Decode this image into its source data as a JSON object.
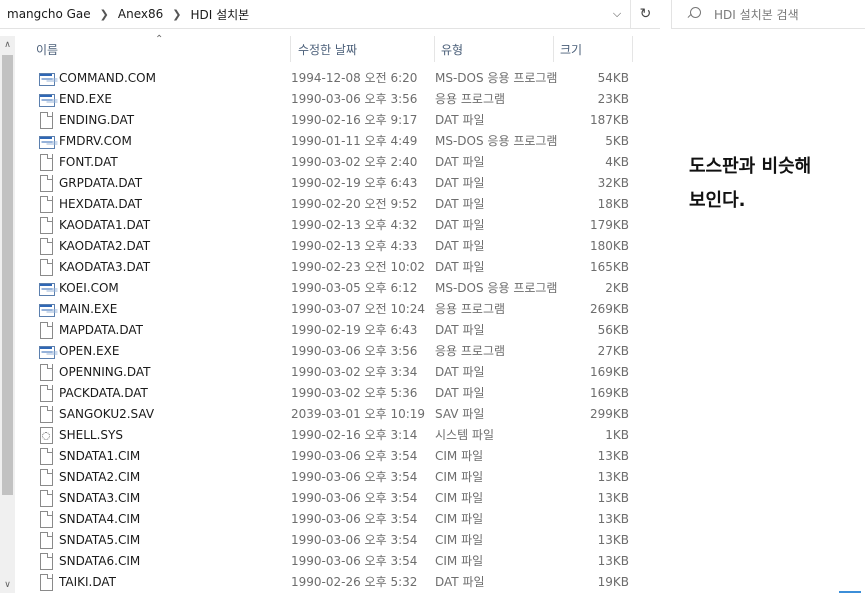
{
  "breadcrumbs": [
    "mangcho Gae",
    "Anex86",
    "HDI 설치본"
  ],
  "search": {
    "placeholder": "HDI 설치본 검색"
  },
  "columns": {
    "name": "이름",
    "date": "수정한 날짜",
    "type": "유형",
    "size": "크기"
  },
  "annotation": [
    "도스판과 비슷해",
    "보인다."
  ],
  "files": [
    {
      "name": "COMMAND.COM",
      "date": "1994-12-08 오전 6:20",
      "type": "MS-DOS 응용 프로그램",
      "size": "54KB",
      "icon": "app-icon"
    },
    {
      "name": "END.EXE",
      "date": "1990-03-06 오후 3:56",
      "type": "응용 프로그램",
      "size": "23KB",
      "icon": "app-icon"
    },
    {
      "name": "ENDING.DAT",
      "date": "1990-02-16 오후 9:17",
      "type": "DAT 파일",
      "size": "187KB",
      "icon": "file-icon"
    },
    {
      "name": "FMDRV.COM",
      "date": "1990-01-11 오후 4:49",
      "type": "MS-DOS 응용 프로그램",
      "size": "5KB",
      "icon": "app-icon"
    },
    {
      "name": "FONT.DAT",
      "date": "1990-03-02 오후 2:40",
      "type": "DAT 파일",
      "size": "4KB",
      "icon": "file-icon"
    },
    {
      "name": "GRPDATA.DAT",
      "date": "1990-02-19 오후 6:43",
      "type": "DAT 파일",
      "size": "32KB",
      "icon": "file-icon"
    },
    {
      "name": "HEXDATA.DAT",
      "date": "1990-02-20 오전 9:52",
      "type": "DAT 파일",
      "size": "18KB",
      "icon": "file-icon"
    },
    {
      "name": "KAODATA1.DAT",
      "date": "1990-02-13 오후 4:32",
      "type": "DAT 파일",
      "size": "179KB",
      "icon": "file-icon"
    },
    {
      "name": "KAODATA2.DAT",
      "date": "1990-02-13 오후 4:33",
      "type": "DAT 파일",
      "size": "180KB",
      "icon": "file-icon"
    },
    {
      "name": "KAODATA3.DAT",
      "date": "1990-02-23 오전 10:02",
      "type": "DAT 파일",
      "size": "165KB",
      "icon": "file-icon"
    },
    {
      "name": "KOEI.COM",
      "date": "1990-03-05 오후 6:12",
      "type": "MS-DOS 응용 프로그램",
      "size": "2KB",
      "icon": "app-icon"
    },
    {
      "name": "MAIN.EXE",
      "date": "1990-03-07 오전 10:24",
      "type": "응용 프로그램",
      "size": "269KB",
      "icon": "app-icon"
    },
    {
      "name": "MAPDATA.DAT",
      "date": "1990-02-19 오후 6:43",
      "type": "DAT 파일",
      "size": "56KB",
      "icon": "file-icon"
    },
    {
      "name": "OPEN.EXE",
      "date": "1990-03-06 오후 3:56",
      "type": "응용 프로그램",
      "size": "27KB",
      "icon": "app-icon"
    },
    {
      "name": "OPENNING.DAT",
      "date": "1990-03-02 오후 3:34",
      "type": "DAT 파일",
      "size": "169KB",
      "icon": "file-icon"
    },
    {
      "name": "PACKDATA.DAT",
      "date": "1990-03-02 오후 5:36",
      "type": "DAT 파일",
      "size": "169KB",
      "icon": "file-icon"
    },
    {
      "name": "SANGOKU2.SAV",
      "date": "2039-03-01 오후 10:19",
      "type": "SAV 파일",
      "size": "299KB",
      "icon": "file-icon"
    },
    {
      "name": "SHELL.SYS",
      "date": "1990-02-16 오후 3:14",
      "type": "시스템 파일",
      "size": "1KB",
      "icon": "system-file-icon"
    },
    {
      "name": "SNDATA1.CIM",
      "date": "1990-03-06 오후 3:54",
      "type": "CIM 파일",
      "size": "13KB",
      "icon": "file-icon"
    },
    {
      "name": "SNDATA2.CIM",
      "date": "1990-03-06 오후 3:54",
      "type": "CIM 파일",
      "size": "13KB",
      "icon": "file-icon"
    },
    {
      "name": "SNDATA3.CIM",
      "date": "1990-03-06 오후 3:54",
      "type": "CIM 파일",
      "size": "13KB",
      "icon": "file-icon"
    },
    {
      "name": "SNDATA4.CIM",
      "date": "1990-03-06 오후 3:54",
      "type": "CIM 파일",
      "size": "13KB",
      "icon": "file-icon"
    },
    {
      "name": "SNDATA5.CIM",
      "date": "1990-03-06 오후 3:54",
      "type": "CIM 파일",
      "size": "13KB",
      "icon": "file-icon"
    },
    {
      "name": "SNDATA6.CIM",
      "date": "1990-03-06 오후 3:54",
      "type": "CIM 파일",
      "size": "13KB",
      "icon": "file-icon"
    },
    {
      "name": "TAIKI.DAT",
      "date": "1990-02-26 오후 5:32",
      "type": "DAT 파일",
      "size": "19KB",
      "icon": "file-icon"
    }
  ]
}
